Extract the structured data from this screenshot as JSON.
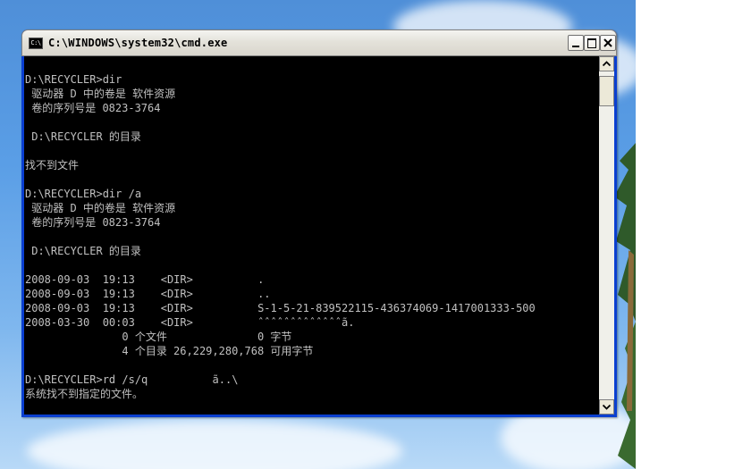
{
  "window": {
    "title": "C:\\WINDOWS\\system32\\cmd.exe",
    "icon_text": "C:\\"
  },
  "console": {
    "lines": [
      "D:\\RECYCLER>dir",
      " 驱动器 D 中的卷是 软件资源",
      " 卷的序列号是 0823-3764",
      "",
      " D:\\RECYCLER 的目录",
      "",
      "找不到文件",
      "",
      "D:\\RECYCLER>dir /a",
      " 驱动器 D 中的卷是 软件资源",
      " 卷的序列号是 0823-3764",
      "",
      " D:\\RECYCLER 的目录",
      "",
      "2008-09-03  19:13    <DIR>          .",
      "2008-09-03  19:13    <DIR>          ..",
      "2008-09-03  19:13    <DIR>          S-1-5-21-839522115-436374069-1417001333-500",
      "2008-03-30  00:03    <DIR>          ˆˆˆˆˆˆˆˆˆˆˆˆˆã.",
      "               0 个文件              0 字节",
      "               4 个目录 26,229,280,768 可用字节",
      "",
      "D:\\RECYCLER>rd /s/q          ã..\\",
      "系统找不到指定的文件。"
    ]
  },
  "colors": {
    "console_bg": "#000000",
    "console_fg": "#c0c0c0",
    "titlebar": "#e4e2da",
    "frame": "#0a3fd0"
  },
  "icons": {
    "app": "console-icon",
    "minimize": "minimize-icon",
    "maximize": "maximize-icon",
    "close": "close-icon",
    "scroll_up": "arrow-up-icon",
    "scroll_down": "arrow-down-icon"
  }
}
